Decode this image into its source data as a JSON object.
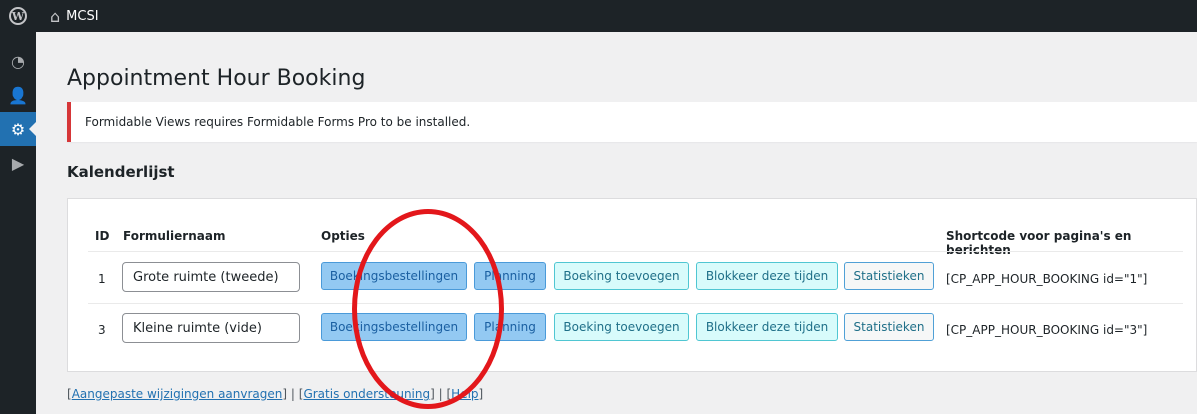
{
  "adminbar": {
    "site_name": "MCSI",
    "wp_logo_icon": "wordpress-logo-icon",
    "home_icon": "home-icon"
  },
  "sidebar": {
    "items": [
      "dashboard-icon",
      "users-icon",
      "settings-icon",
      "play-icon"
    ]
  },
  "page": {
    "title": "Appointment Hour Booking",
    "notice": "Formidable Views requires Formidable Forms Pro to be installed.",
    "section_title": "Kalenderlijst"
  },
  "table": {
    "headers": {
      "id": "ID",
      "name": "Formuliernaam",
      "options": "Opties",
      "shortcode": "Shortcode voor pagina's en berichten"
    },
    "rows": [
      {
        "id": "1",
        "name": "Grote ruimte (tweede)",
        "btn_orders": "Boekingsbestellingen",
        "btn_planning": "Planning",
        "btn_add": "Boeking toevoegen",
        "btn_block": "Blokkeer deze tijden",
        "btn_stats": "Statistieken",
        "shortcode": "[CP_APP_HOUR_BOOKING id=\"1\"]"
      },
      {
        "id": "3",
        "name": "Kleine ruimte (vide)",
        "btn_orders": "Boekingsbestellingen",
        "btn_planning": "Planning",
        "btn_add": "Boeking toevoegen",
        "btn_block": "Blokkeer deze tijden",
        "btn_stats": "Statistieken",
        "shortcode": "[CP_APP_HOUR_BOOKING id=\"3\"]"
      }
    ]
  },
  "footer": {
    "open1": "[",
    "link1": "Aangepaste wijzigingen aanvragen",
    "close1": "] | [",
    "link2": "Gratis ondersteuning",
    "close2": "] | [",
    "link3": "Help",
    "close3": "]"
  },
  "colors": {
    "admin_bar": "#1d2327",
    "notice_error": "#d63638",
    "annotation_circle": "#e3171b"
  }
}
